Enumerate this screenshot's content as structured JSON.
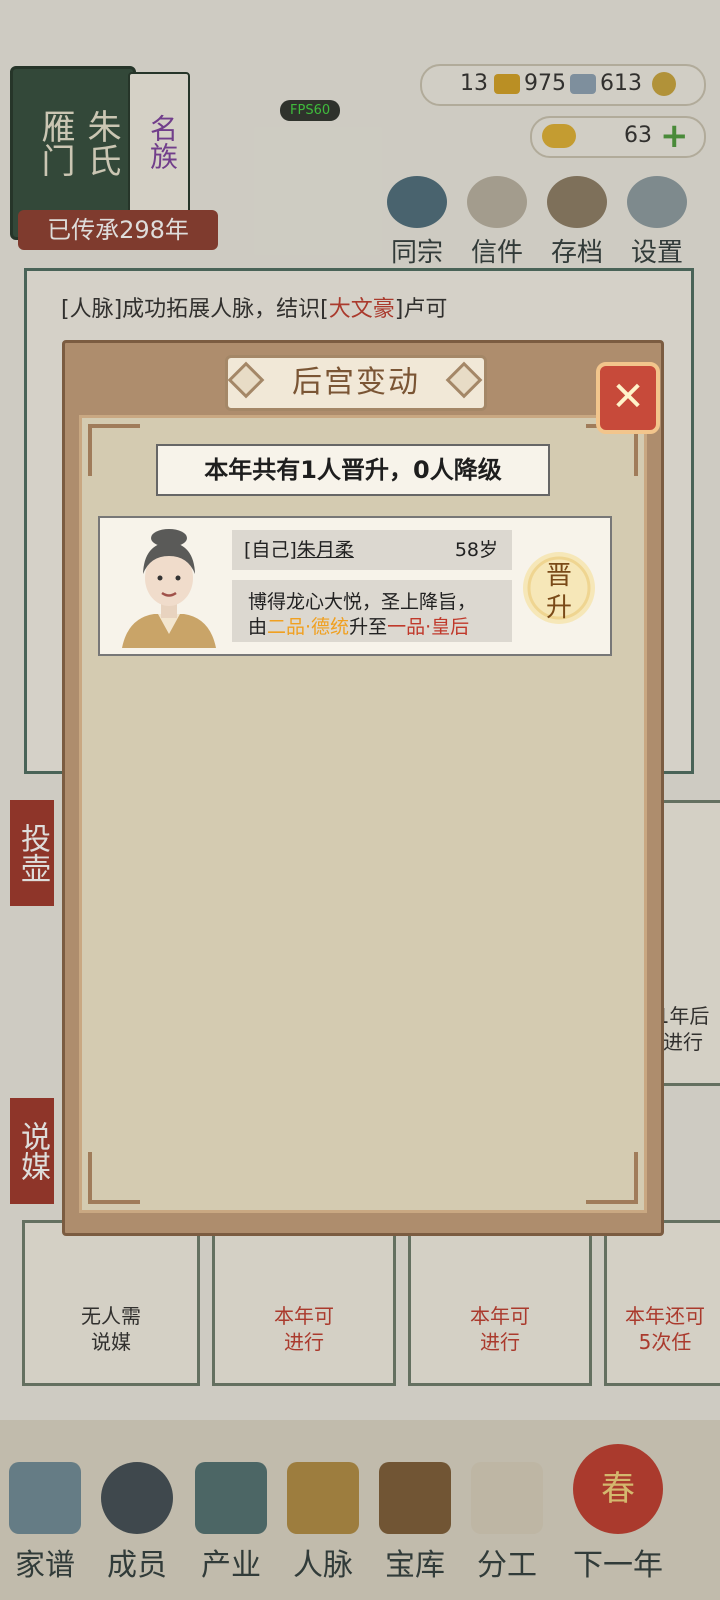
{
  "clan": {
    "book_text_1": "朱氏",
    "book_text_2": "雁门",
    "side_text": "名族",
    "legacy": "已传承298年"
  },
  "fps": "FPS60",
  "resources": {
    "gold_bars": "13",
    "silver_bars": "975",
    "coins": "613",
    "ingots": "63"
  },
  "top_buttons": [
    "同宗",
    "信件",
    "存档",
    "设置"
  ],
  "log": {
    "line1_prefix": "[人脉]成功拓展人脉，结识[",
    "line1_highlight": "大文豪",
    "line1_suffix": "]卢可"
  },
  "side_tags": [
    "投壶",
    "说媒"
  ],
  "cards": [
    {
      "line1": "无人需",
      "line2": "说媒"
    },
    {
      "line1": "本年可",
      "line2": "进行"
    },
    {
      "line1": "本年可",
      "line2": "进行"
    },
    {
      "line1": "本年还可",
      "line2": "5次任"
    }
  ],
  "right_card": {
    "line1": "1年后",
    "line2": "进行"
  },
  "nav": [
    "家谱",
    "成员",
    "产业",
    "人脉",
    "宝库",
    "分工",
    "下一年"
  ],
  "nav_badge": "春",
  "modal": {
    "title": "后宫变动",
    "close_label": "✕",
    "summary": "本年共有1人晋升，0人降级",
    "entry": {
      "tag": "[自己]",
      "name": "朱月柔",
      "age": "58岁",
      "desc_line1": "博得龙心大悦，圣上降旨，",
      "desc_prefix": "由",
      "from_rank": "二品·德统",
      "desc_mid": "升至",
      "to_rank": "一品·皇后",
      "badge": "晋升"
    }
  },
  "colors": {
    "modal_frame": "#ae8d6d",
    "modal_inner": "#d4cbb1",
    "accent_red": "#c0392b",
    "accent_orange": "#f0a020"
  }
}
